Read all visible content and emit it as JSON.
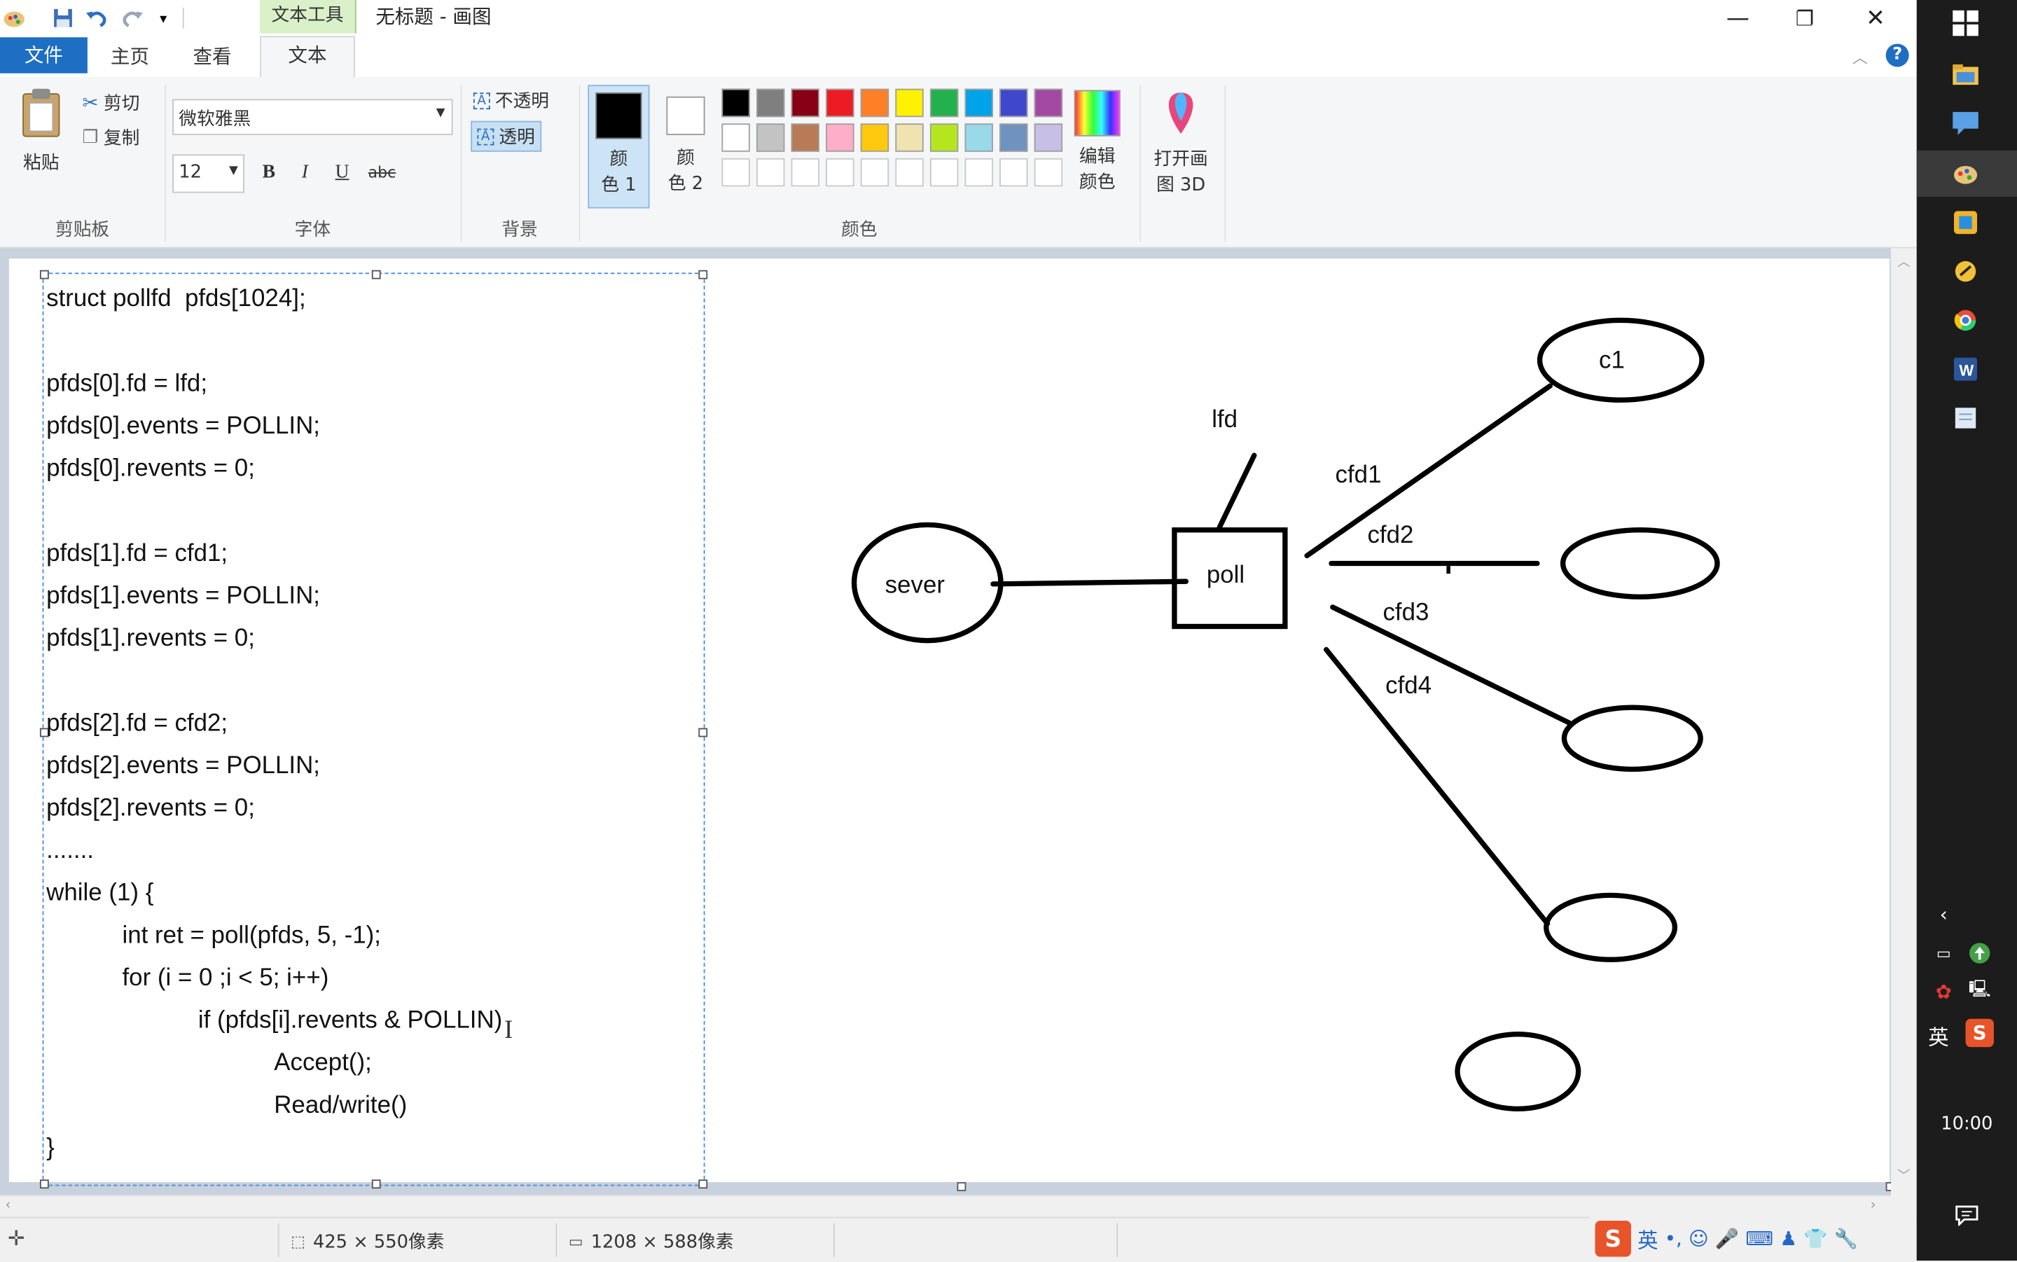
{
  "titlebar": {
    "context_tab": "文本工具",
    "window_title": "无标题 - 画图",
    "minimize": "—",
    "maximize": "❐",
    "close": "✕"
  },
  "menu": {
    "file": "文件",
    "home": "主页",
    "view": "查看",
    "text": "文本",
    "help": "?"
  },
  "ribbon": {
    "clipboard": {
      "paste": "粘贴",
      "cut": "剪切",
      "copy": "复制",
      "group": "剪贴板"
    },
    "font": {
      "family": "微软雅黑",
      "size": "12",
      "bold": "B",
      "italic": "I",
      "underline": "U",
      "strike": "abc",
      "group": "字体"
    },
    "background": {
      "opaque": "不透明",
      "transparent": "透明",
      "group": "背景"
    },
    "colors": {
      "color1_line1": "颜",
      "color1_line2": "色 1",
      "color2_line1": "颜",
      "color2_line2": "色 2",
      "edit_line1": "编辑",
      "edit_line2": "颜色",
      "paint3d_line1": "打开画",
      "paint3d_line2": "图 3D",
      "group": "颜色",
      "color1": "#000000",
      "color2": "#ffffff",
      "palette_row1": [
        "#000000",
        "#7f7f7f",
        "#880015",
        "#ed1c24",
        "#ff7f27",
        "#fff200",
        "#22b14c",
        "#00a2e8",
        "#3f48cc",
        "#a349a4"
      ],
      "palette_row2": [
        "#ffffff",
        "#c3c3c3",
        "#b97a57",
        "#ffaec9",
        "#ffc90e",
        "#efe4b0",
        "#b5e61d",
        "#99d9ea",
        "#7092be",
        "#c8bfe7"
      ]
    }
  },
  "code_lines": [
    "struct pollfd  pfds[1024];",
    "pfds[0].fd = lfd;",
    "pfds[0].events = POLLIN;",
    "pfds[0].revents = 0;",
    "pfds[1].fd = cfd1;",
    "pfds[1].events = POLLIN;",
    "pfds[1].revents = 0;",
    "pfds[2].fd = cfd2;",
    "pfds[2].events = POLLIN;",
    "pfds[2].revents = 0;",
    ".......",
    "while (1) {",
    "int ret = poll(pfds, 5, -1);",
    "for (i = 0 ;i < 5; i++)",
    "if (pfds[i].revents & POLLIN)",
    "Accept();",
    "Read/write()",
    "}"
  ],
  "diagram": {
    "sever": "sever",
    "poll": "poll",
    "lfd": "lfd",
    "c1": "c1",
    "cfd1": "cfd1",
    "cfd2": "cfd2",
    "cfd3": "cfd3",
    "cfd4": "cfd4"
  },
  "status": {
    "selection_size": "425 × 550像素",
    "canvas_size": "1208 × 588像素"
  },
  "ime": {
    "lang": "英"
  },
  "taskbar": {
    "clock": "10:00",
    "ime_lang": "英"
  }
}
